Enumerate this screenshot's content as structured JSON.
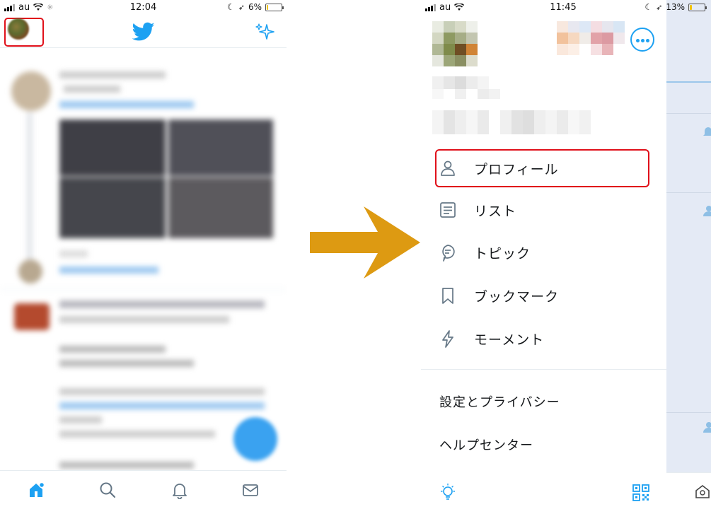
{
  "left_screen": {
    "status": {
      "carrier": "au",
      "time": "12:04",
      "battery_text": "6%",
      "battery_level": 0.06
    },
    "header": {
      "avatar_icon": "profile-avatar",
      "logo_icon": "twitter-bird-icon",
      "sparkle_icon": "sparkle-icon"
    },
    "bottom_nav": [
      "home-icon",
      "search-icon",
      "bell-icon",
      "mail-icon"
    ]
  },
  "right_screen": {
    "status": {
      "carrier": "au",
      "time": "11:45",
      "battery_text": "13%",
      "battery_level": 0.13
    },
    "menu": [
      {
        "label": "プロフィール",
        "icon": "person-icon"
      },
      {
        "label": "リスト",
        "icon": "list-icon"
      },
      {
        "label": "トピック",
        "icon": "topic-icon"
      },
      {
        "label": "ブックマーク",
        "icon": "bookmark-icon"
      },
      {
        "label": "モーメント",
        "icon": "lightning-icon"
      }
    ],
    "secondary": {
      "settings": "設定とプライバシー",
      "help": "ヘルプセンター"
    },
    "bottom": {
      "bulb_icon": "lightbulb-icon",
      "qr_icon": "qr-code-icon"
    }
  },
  "colors": {
    "twitter_blue": "#1da1f2",
    "highlight_red": "#e0101a",
    "arrow": "#dd9a12"
  }
}
